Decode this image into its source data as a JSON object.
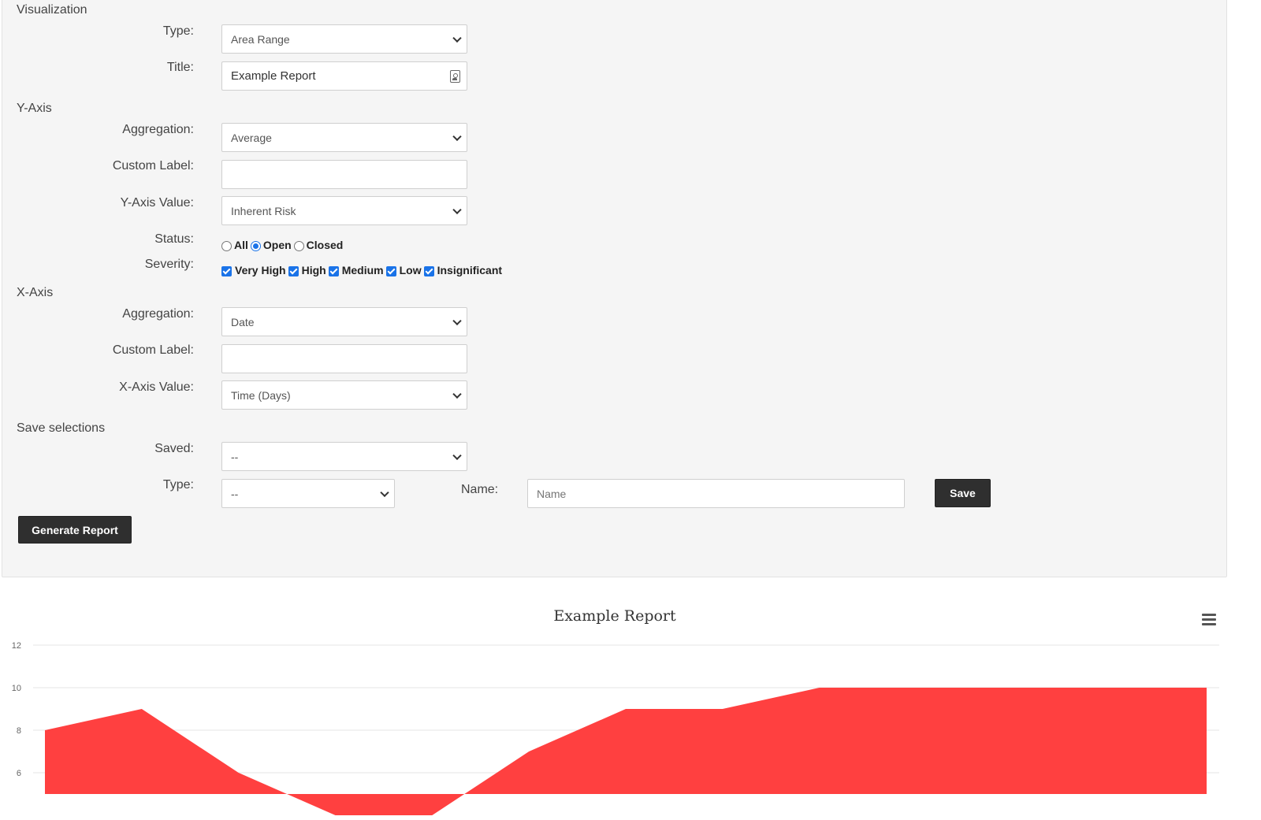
{
  "visualization": {
    "section_title": "Visualization",
    "type_label": "Type:",
    "type_value": "Area Range",
    "title_label": "Title:",
    "title_value": "Example Report"
  },
  "y_axis": {
    "section_title": "Y-Axis",
    "aggregation_label": "Aggregation:",
    "aggregation_value": "Average",
    "custom_label_label": "Custom Label:",
    "custom_label_value": "",
    "value_label": "Y-Axis Value:",
    "value_value": "Inherent Risk",
    "status_label": "Status:",
    "status_options": [
      {
        "label": "All",
        "selected": false
      },
      {
        "label": "Open",
        "selected": true
      },
      {
        "label": "Closed",
        "selected": false
      }
    ],
    "severity_label": "Severity:",
    "severity_options": [
      {
        "label": "Very High",
        "checked": true
      },
      {
        "label": "High",
        "checked": true
      },
      {
        "label": "Medium",
        "checked": true
      },
      {
        "label": "Low",
        "checked": true
      },
      {
        "label": "Insignificant",
        "checked": true
      }
    ]
  },
  "x_axis": {
    "section_title": "X-Axis",
    "aggregation_label": "Aggregation:",
    "aggregation_value": "Date",
    "custom_label_label": "Custom Label:",
    "custom_label_value": "",
    "value_label": "X-Axis Value:",
    "value_value": "Time (Days)"
  },
  "save_selections": {
    "section_title": "Save selections",
    "saved_label": "Saved:",
    "saved_value": "--",
    "type_label": "Type:",
    "type_value": "--",
    "name_label": "Name:",
    "name_placeholder": "Name",
    "save_button": "Save"
  },
  "generate_button": "Generate Report",
  "colors": {
    "area_fill": "#ff4040",
    "button_bg": "#2f2f2f",
    "accent": "#1a73e8"
  },
  "chart_data": {
    "type": "area",
    "title": "Example Report",
    "xlabel": "",
    "ylabel": "",
    "ylim": [
      5,
      12
    ],
    "yticks": [
      "12",
      "10",
      "8",
      "6"
    ],
    "grid": true,
    "x_index": [
      0,
      1,
      2,
      3,
      4,
      5,
      6,
      7,
      8,
      9,
      10,
      11,
      12
    ],
    "upper": [
      8,
      9,
      6,
      4,
      4,
      7,
      9,
      9,
      10,
      10,
      10,
      10,
      10
    ],
    "lower": [
      5,
      5,
      5,
      5,
      5,
      5,
      5,
      5,
      5,
      5,
      5,
      5,
      5
    ]
  }
}
